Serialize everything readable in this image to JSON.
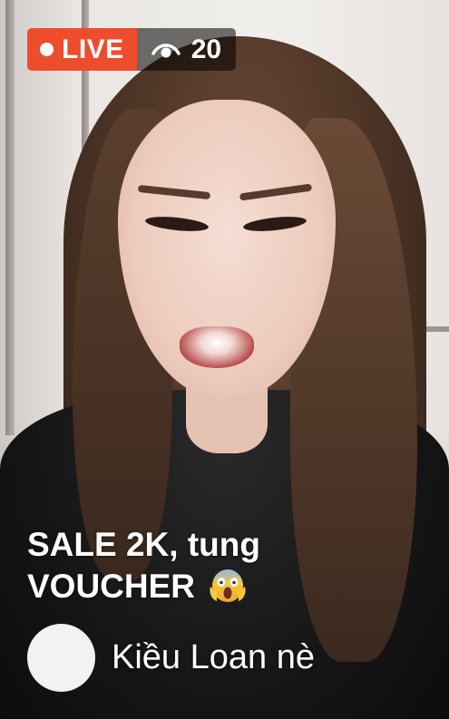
{
  "live_badge": {
    "label": "LIVE",
    "viewer_count": "20"
  },
  "caption": {
    "line1": "SALE 2K, tung",
    "line2": "VOUCHER",
    "emoji": "face-screaming-in-fear-emoji"
  },
  "host": {
    "name": "Kiều Loan nè"
  },
  "colors": {
    "live_accent": "#ee4d2d",
    "viewer_bg": "rgba(0,0,0,0.55)",
    "text": "#ffffff"
  },
  "icons": {
    "viewer": "eye-icon",
    "live": "live-dot-icon"
  }
}
